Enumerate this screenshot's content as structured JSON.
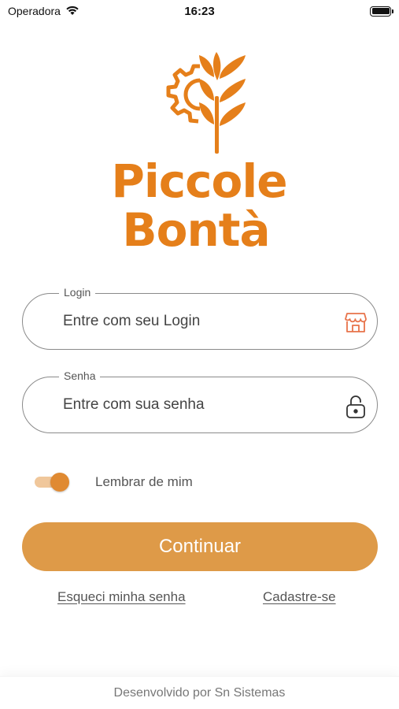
{
  "status_bar": {
    "carrier": "Operadora",
    "time": "16:23"
  },
  "brand": {
    "line1": "Piccole",
    "line2": "Bontà",
    "color": "#e57f1a"
  },
  "login": {
    "label": "Login",
    "placeholder": "Entre com seu Login",
    "icon": "store-icon"
  },
  "senha": {
    "label": "Senha",
    "placeholder": "Entre com sua senha",
    "icon": "lock-icon"
  },
  "remember": {
    "label": "Lembrar de mim",
    "on": true
  },
  "continue_label": "Continuar",
  "links": {
    "forgot": "Esqueci minha senha",
    "signup": "Cadastre-se"
  },
  "footer": "Desenvolvido por Sn Sistemas",
  "colors": {
    "accent": "#de9a48",
    "toggle_thumb": "#e08a32",
    "toggle_track": "#f0c79b"
  }
}
